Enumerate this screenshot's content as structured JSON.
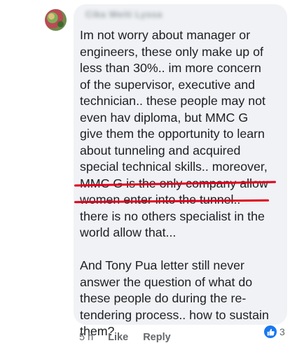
{
  "comment": {
    "author_name": "Cika Weiti Lyssa",
    "lines_before_underline": [
      "Im not worry about manager or",
      "engineers, these only make up of",
      "less than 30%.. im more concern",
      "of the supervisor, executive and",
      "technician.. these people may not",
      "even hav diploma, but MMC G",
      "give them the opportunity to learn",
      "about tunneling and acquired",
      "special technical skills.. moreover,"
    ],
    "underlined_lines": [
      "MMC G is the only company allow",
      "women enter into the tunnel.."
    ],
    "lines_after_underline": [
      "there is no others specialist in the",
      "world allow that..."
    ],
    "second_paragraph": [
      "And Tony Pua letter still never",
      "answer the question of what do",
      "these people do during the re-",
      "tendering process.. how to sustain",
      "them?"
    ]
  },
  "actions": {
    "time": "5 h",
    "like_label": "Like",
    "reply_label": "Reply"
  },
  "reactions": {
    "icon": "thumbs-up-icon",
    "count": "3"
  },
  "colors": {
    "bubble": "#f0f2f5",
    "underline": "#e0001b",
    "like_blue": "#1877f2"
  }
}
